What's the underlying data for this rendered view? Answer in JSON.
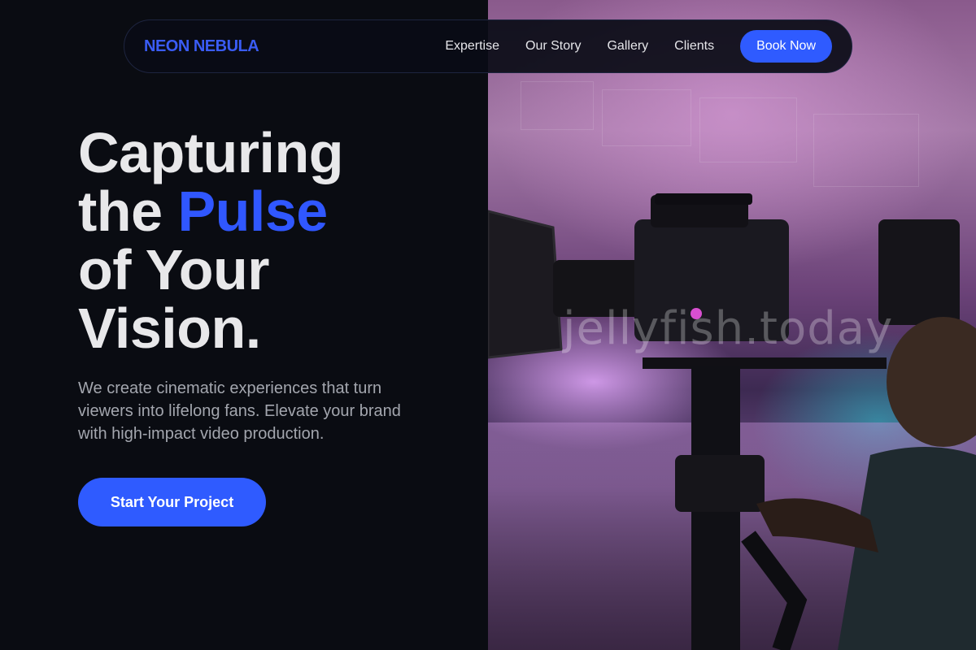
{
  "nav": {
    "brand": "NEON NEBULA",
    "links": [
      "Expertise",
      "Our Story",
      "Gallery",
      "Clients"
    ],
    "cta": "Book Now"
  },
  "hero": {
    "title_line1": "Capturing",
    "title_line2_pre": "the ",
    "title_line2_accent": "Pulse",
    "title_line3": "of Your",
    "title_line4": "Vision.",
    "subtitle": "We create cinematic experiences that turn viewers into lifelong fans. Elevate your brand with high-impact video production.",
    "cta": "Start Your Project"
  },
  "photo": {
    "watermark": "jellyfish.today",
    "description_icon": "camera-operator-photo"
  },
  "colors": {
    "accent": "#2f5bff",
    "background": "#0a0c12",
    "text": "#e8e8ea",
    "muted": "#a3a6ae"
  }
}
